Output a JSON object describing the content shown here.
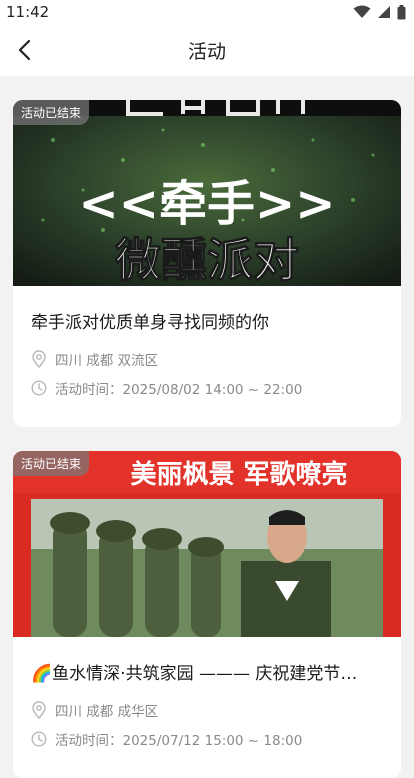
{
  "status_bar": {
    "time": "11:42"
  },
  "header": {
    "title": "活动"
  },
  "events": [
    {
      "badge": "活动已结束",
      "cover_text_top": "&lt;&lt;牵手&gt;&gt;",
      "cover_text_bottom": "微醺派对",
      "title": "牵手派对优质单身寻找同频的你",
      "location": "四川 成都 双流区",
      "time": "活动时间：2025/08/02 14:00 ~ 22:00"
    },
    {
      "badge": "活动已结束",
      "cover_text_top": "美丽枫景 军歌嘹亮",
      "title": "🌈鱼水情深·共筑家园 ——— 庆祝建党节…",
      "location": "四川 成都 成华区",
      "time": "活动时间：2025/07/12 15:00 ~ 18:00"
    }
  ]
}
